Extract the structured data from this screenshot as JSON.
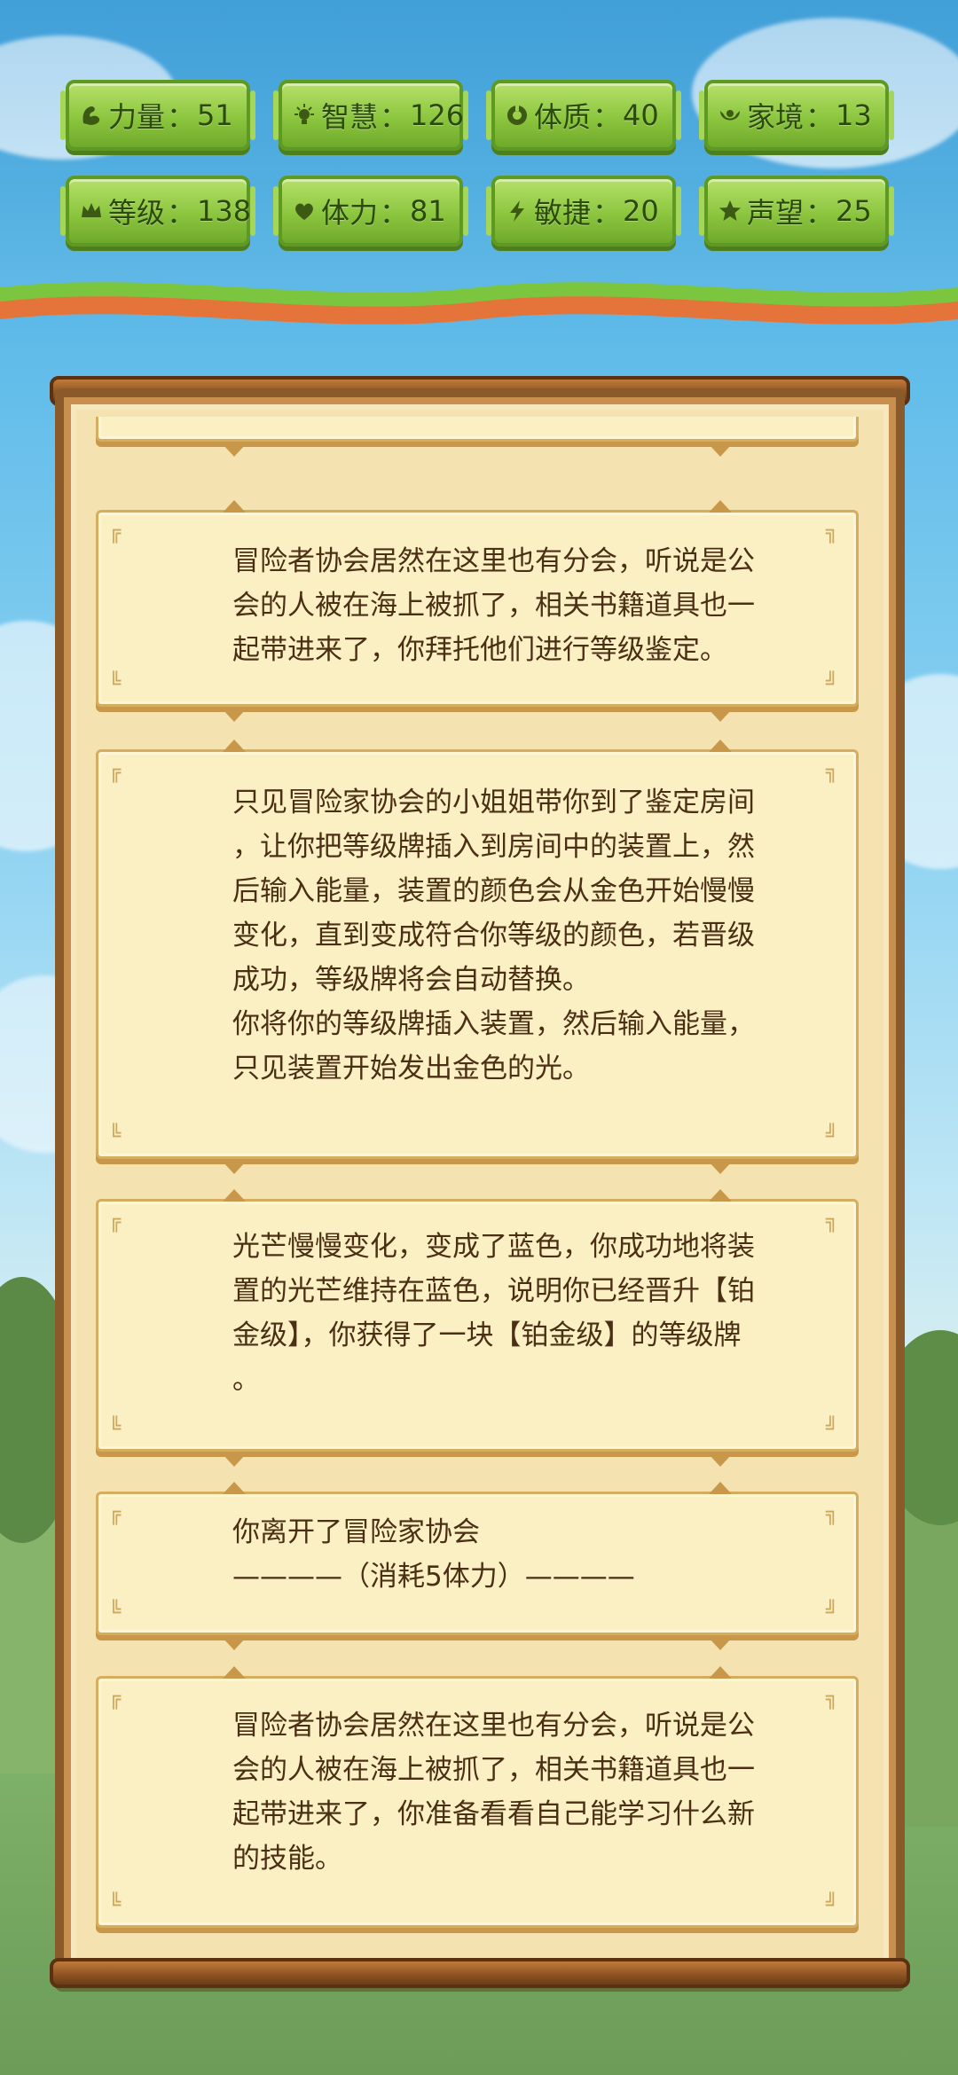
{
  "stats": [
    {
      "icon": "strength-arm-icon",
      "label": "力量",
      "sep": "：",
      "value": "51"
    },
    {
      "icon": "lightbulb-icon",
      "label": "智慧",
      "sep": "：",
      "value": "126"
    },
    {
      "icon": "constitution-ring-icon",
      "label": "体质",
      "sep": "：",
      "value": "40"
    },
    {
      "icon": "family-icon",
      "label": "家境",
      "sep": "：",
      "value": "13"
    },
    {
      "icon": "crown-icon",
      "label": "等级",
      "sep": "：",
      "value": "138"
    },
    {
      "icon": "heart-icon",
      "label": "体力",
      "sep": "：",
      "value": "81"
    },
    {
      "icon": "lightning-icon",
      "label": "敏捷",
      "sep": "：",
      "value": "20"
    },
    {
      "icon": "star-icon",
      "label": "声望",
      "sep": "：",
      "value": "25"
    }
  ],
  "log": {
    "entries": [
      {
        "text": ""
      },
      {
        "text": "冒险者协会居然在这里也有分会，听说是公\n会的人被在海上被抓了，相关书籍道具也一\n起带进来了，你拜托他们进行等级鉴定。"
      },
      {
        "text": "只见冒险家协会的小姐姐带你到了鉴定房间\n，让你把等级牌插入到房间中的装置上，然\n后输入能量，装置的颜色会从金色开始慢慢\n变化，直到变成符合你等级的颜色，若晋级\n成功，等级牌将会自动替换。\n你将你的等级牌插入装置，然后输入能量，\n只见装置开始发出金色的光。"
      },
      {
        "text": "光芒慢慢变化，变成了蓝色，你成功地将装\n置的光芒维持在蓝色，说明你已经晋升【铂\n金级】，你获得了一块【铂金级】的等级牌\n。"
      },
      {
        "text": "你离开了冒险家协会\n————（消耗5体力）————"
      },
      {
        "text": "冒险者协会居然在这里也有分会，听说是公\n会的人被在海上被抓了，相关书籍道具也一\n起带进来了，你准备看看自己能学习什么新\n的技能。"
      }
    ]
  }
}
